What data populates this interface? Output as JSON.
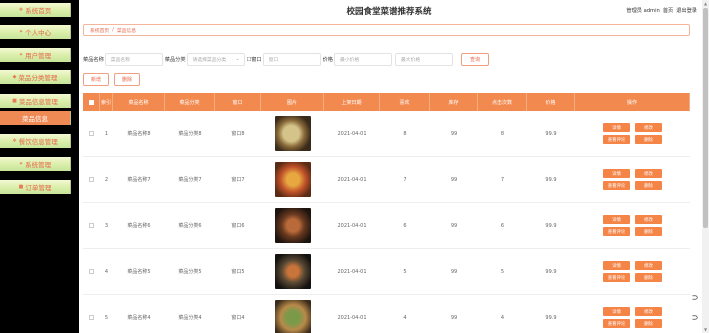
{
  "header": {
    "title": "校园食堂菜谱推荐系统",
    "user_label": "管理员 admin",
    "home": "首页",
    "logout": "退出登录"
  },
  "sidebar": {
    "items": [
      {
        "label": "系统首页",
        "icon": "home-icon"
      },
      {
        "label": "个人中心",
        "icon": "user-icon"
      },
      {
        "label": "用户管理",
        "icon": "users-icon"
      },
      {
        "label": "菜品分类管理",
        "icon": "tag-icon"
      },
      {
        "label": "菜品信息管理",
        "icon": "list-icon"
      },
      {
        "label": "菜品信息",
        "icon": "",
        "active": true
      },
      {
        "label": "餐饮信息管理",
        "icon": "info-icon"
      },
      {
        "label": "系统管理",
        "icon": "gear-icon"
      },
      {
        "label": "订单管理",
        "icon": "order-icon"
      }
    ]
  },
  "breadcrumb": {
    "home": "系统首页",
    "sep": "/",
    "current": "菜品信息"
  },
  "filters": {
    "name_label": "菜品名称",
    "name_placeholder": "菜品名称",
    "category_label": "菜品分类",
    "category_placeholder": "请选择菜品分类",
    "window_label": "窗口",
    "window_placeholder": "窗口",
    "price_label": "价格",
    "price_min_placeholder": "最小价格",
    "price_max_placeholder": "最大价格",
    "search": "查询"
  },
  "actions": {
    "add": "新增",
    "delete": "删除"
  },
  "table": {
    "headers": [
      "索引",
      "菜品名称",
      "菜品分类",
      "窗口",
      "图片",
      "上架日期",
      "喜欢",
      "库存",
      "点击次数",
      "价格",
      "操作"
    ],
    "rows": [
      {
        "idx": "1",
        "name": "菜品名称8",
        "category": "菜品分类8",
        "window": "窗口8",
        "date": "2021-04-01",
        "like": "8",
        "stock": "99",
        "clicks": "8",
        "price": "99.9"
      },
      {
        "idx": "2",
        "name": "菜品名称7",
        "category": "菜品分类7",
        "window": "窗口7",
        "date": "2021-04-01",
        "like": "7",
        "stock": "99",
        "clicks": "7",
        "price": "99.9"
      },
      {
        "idx": "3",
        "name": "菜品名称6",
        "category": "菜品分类6",
        "window": "窗口6",
        "date": "2021-04-01",
        "like": "6",
        "stock": "99",
        "clicks": "6",
        "price": "99.9"
      },
      {
        "idx": "4",
        "name": "菜品名称5",
        "category": "菜品分类5",
        "window": "窗口5",
        "date": "2021-04-01",
        "like": "5",
        "stock": "99",
        "clicks": "5",
        "price": "99.9"
      },
      {
        "idx": "5",
        "name": "菜品名称4",
        "category": "菜品分类4",
        "window": "窗口4",
        "date": "2021-04-01",
        "like": "4",
        "stock": "99",
        "clicks": "4",
        "price": "99.9"
      }
    ],
    "ops": {
      "detail": "详情",
      "edit": "修改",
      "review": "查看评论",
      "delete": "删除"
    }
  },
  "colors": {
    "accent": "#f28a50",
    "accent_dark": "#e8674a",
    "sidebar_bg": "#000000"
  }
}
